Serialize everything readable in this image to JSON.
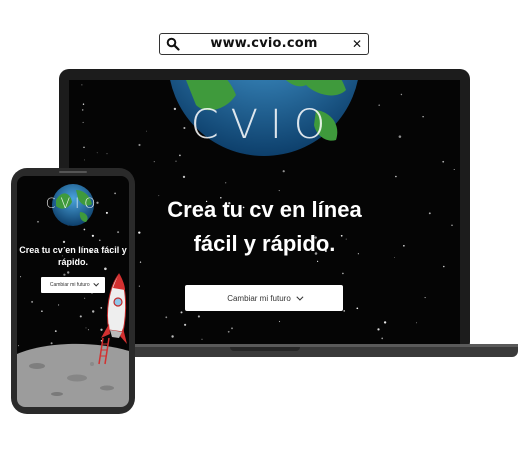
{
  "address_bar": {
    "url": "www.cvio.com",
    "search_icon": "search-icon",
    "close_icon": "close-icon"
  },
  "desktop": {
    "logo": "CVIO",
    "headline_line1": "Crea tu cv en línea",
    "headline_line2": "fácil y rápido.",
    "cta_label": "Cambiar mi futuro"
  },
  "mobile": {
    "logo": "CVIO",
    "headline_line1": "Crea tu cv en línea fácil y",
    "headline_line2": "rápido.",
    "cta_label": "Cambiar mi futuro"
  },
  "colors": {
    "screen_bg": "#050505",
    "button_bg": "#ffffff",
    "text": "#ffffff",
    "ocean": "#1f6fa8",
    "land": "#3f9a3c"
  }
}
